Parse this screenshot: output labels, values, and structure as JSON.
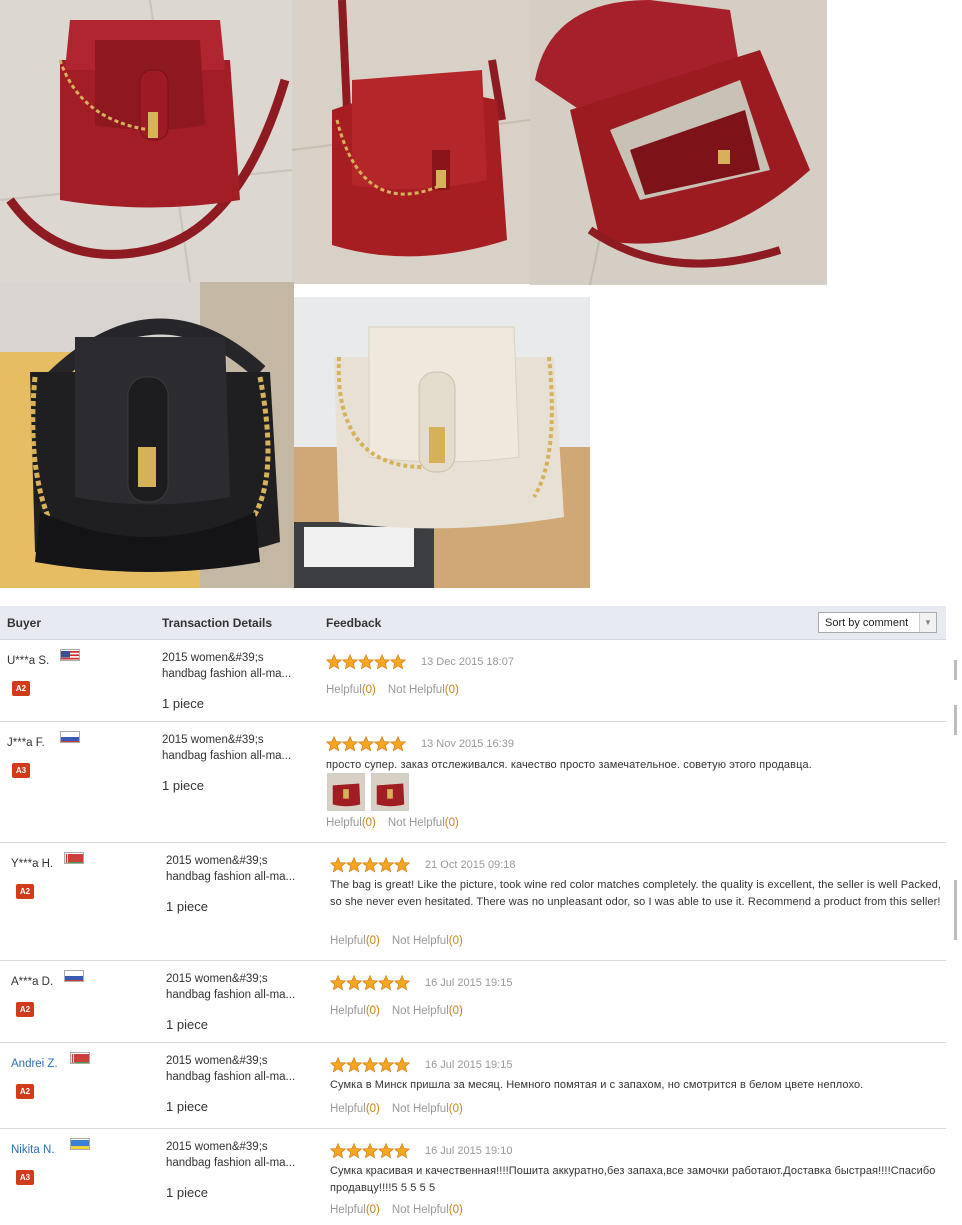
{
  "photos": [
    {
      "name": "red-bag-front-photo",
      "color": "#a31d27"
    },
    {
      "name": "red-bag-side-photo",
      "color": "#a61e22"
    },
    {
      "name": "red-bag-open-photo",
      "color": "#9c1b20"
    },
    {
      "name": "black-bag-photo",
      "color": "#1f1f22"
    },
    {
      "name": "white-bag-photo",
      "color": "#e7e0d4"
    }
  ],
  "table": {
    "headers": {
      "buyer": "Buyer",
      "transaction": "Transaction Details",
      "feedback": "Feedback"
    },
    "sort": {
      "selected": "Sort by comment"
    }
  },
  "helpful_label": "Helpful",
  "not_helpful_label": "Not Helpful",
  "rows": [
    {
      "buyer": "U***a S.",
      "country": "us",
      "level": "A2",
      "product": "2015 women&#39;s handbag fashion all-ma...",
      "quantity": "1 piece",
      "stars": 5,
      "date": "13 Dec 2015 18:07",
      "text": "",
      "helpful": "(0)",
      "not_helpful": "(0)"
    },
    {
      "buyer": "J***a F.",
      "country": "ru",
      "level": "A3",
      "product": "2015 women&#39;s handbag fashion all-ma...",
      "quantity": "1 piece",
      "stars": 5,
      "date": "13 Nov 2015 16:39",
      "text": "просто супер. заказ отслеживался. качество просто замечательное. советую этого продавца.",
      "helpful": "(0)",
      "not_helpful": "(0)"
    },
    {
      "buyer": "Y***a H.",
      "country": "by",
      "level": "A2",
      "product": "2015 women&#39;s handbag fashion all-ma...",
      "quantity": "1 piece",
      "stars": 5,
      "date": "21 Oct 2015 09:18",
      "text": "The bag is great! Like the picture, took wine red color matches completely. the quality is excellent, the seller is well Packed, so she never even hesitated. There was no unpleasant odor, so I was able to use it. Recommend a product from this seller!",
      "helpful": "(0)",
      "not_helpful": "(0)"
    },
    {
      "buyer": "A***a D.",
      "country": "ru",
      "level": "A2",
      "product": "2015 women&#39;s handbag fashion all-ma...",
      "quantity": "1 piece",
      "stars": 5,
      "date": "16 Jul 2015 19:15",
      "text": "",
      "helpful": "(0)",
      "not_helpful": "(0)"
    },
    {
      "buyer": "Andrei Z.",
      "country": "by",
      "level": "A2",
      "product": "2015 women&#39;s handbag fashion all-ma...",
      "quantity": "1 piece",
      "stars": 5,
      "date": "16 Jul 2015 19:15",
      "text": "Сумка в Минск пришла за месяц. Немного помятая и с запахом, но смотрится в белом цвете неплохо.",
      "helpful": "(0)",
      "not_helpful": "(0)"
    },
    {
      "buyer": "Nikita N.",
      "country": "ua",
      "level": "A3",
      "product": "2015 women&#39;s handbag fashion all-ma...",
      "quantity": "1 piece",
      "stars": 5,
      "date": "16 Jul 2015 19:10",
      "text": "Сумка красивая и качественная!!!!Пошита аккуратно,без запаха,все замочки работают.Доставка быстрая!!!!Спасибо продавцу!!!!5 5 5 5 5",
      "helpful": "(0)",
      "not_helpful": "(0)"
    }
  ]
}
